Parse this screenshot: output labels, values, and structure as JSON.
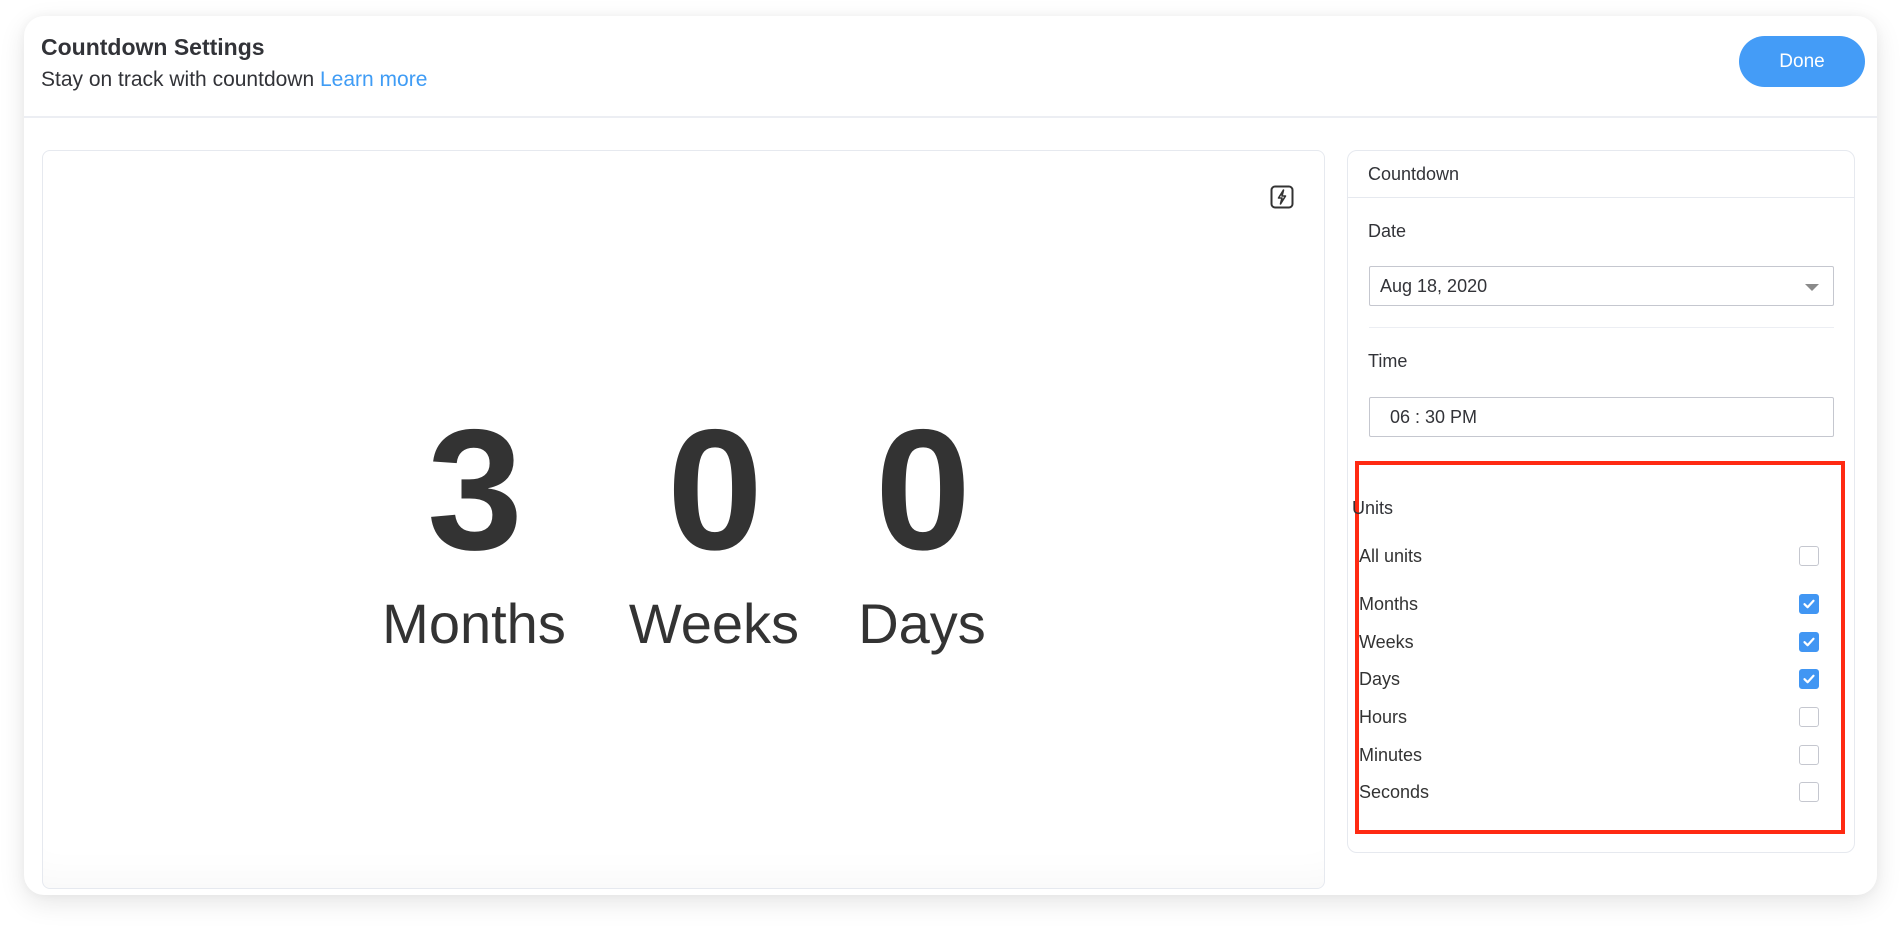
{
  "header": {
    "title": "Countdown Settings",
    "subtitle": "Stay on track with countdown",
    "learn_more": "Learn more",
    "done_label": "Done"
  },
  "preview": {
    "flash_icon": "lightning-icon",
    "units": [
      {
        "value": "3",
        "label": "Months"
      },
      {
        "value": "0",
        "label": "Weeks"
      },
      {
        "value": "0",
        "label": "Days"
      }
    ]
  },
  "settings": {
    "section_title": "Countdown",
    "date_label": "Date",
    "date_value": "Aug 18, 2020",
    "time_label": "Time",
    "time_value": "06 : 30 PM",
    "units_label": "Units",
    "all_units": {
      "label": "All units",
      "checked": false
    },
    "unit_options": [
      {
        "label": "Months",
        "checked": true
      },
      {
        "label": "Weeks",
        "checked": true
      },
      {
        "label": "Days",
        "checked": true
      },
      {
        "label": "Hours",
        "checked": false
      },
      {
        "label": "Minutes",
        "checked": false
      },
      {
        "label": "Seconds",
        "checked": false
      }
    ]
  },
  "colors": {
    "accent": "#449cf7",
    "link": "#3f9cf5",
    "checkbox_checked": "#4196f3",
    "highlight_border": "#ff2a12",
    "text": "#323338"
  }
}
